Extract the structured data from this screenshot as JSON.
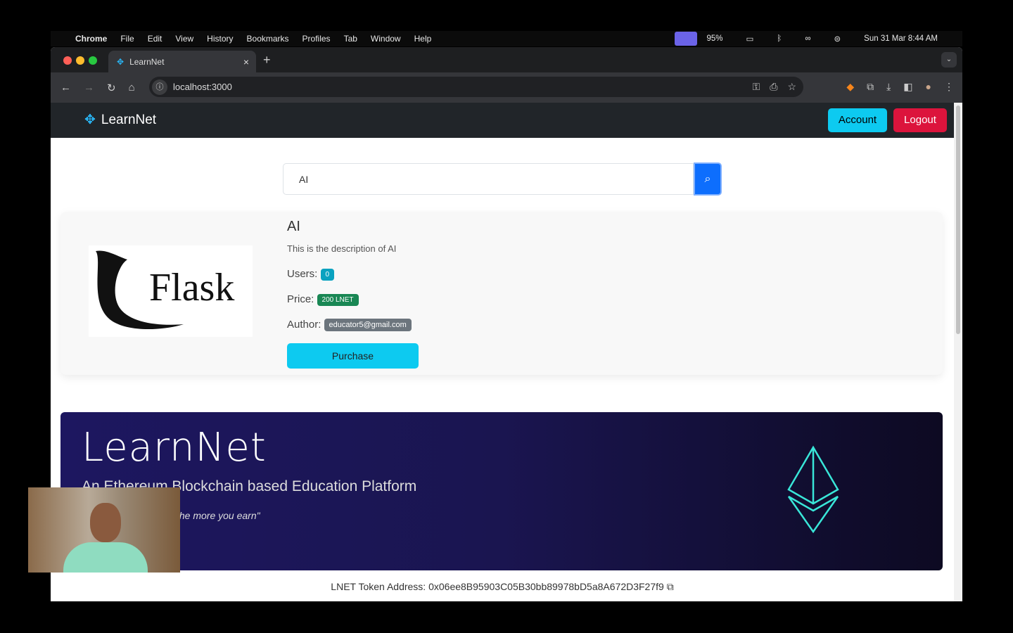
{
  "menubar": {
    "app": "Chrome",
    "items": [
      "File",
      "Edit",
      "View",
      "History",
      "Bookmarks",
      "Profiles",
      "Tab",
      "Window",
      "Help"
    ],
    "battery": "95%",
    "datetime": "Sun 31 Mar  8:44 AM"
  },
  "browser": {
    "tab_title": "LearnNet",
    "url": "localhost:3000"
  },
  "navbar": {
    "brand": "LearnNet",
    "account": "Account",
    "logout": "Logout"
  },
  "search": {
    "value": "AI"
  },
  "course": {
    "title": "AI",
    "description": "This is the description of AI",
    "users_label": "Users:",
    "users": "0",
    "price_label": "Price:",
    "price": "200 LNET",
    "author_label": "Author:",
    "author": "educator5@gmail.com",
    "purchase": "Purchase",
    "image_logo_text": "Flask"
  },
  "hero": {
    "title": "LearnNet",
    "subtitle": "An Ethereum Blockchain based Education Platform",
    "tagline": "the more you earn\""
  },
  "footer": {
    "token_address": "LNET Token Address: 0x06ee8B95903C05B30bb89978bD5a8A672D3F27f9"
  },
  "colors": {
    "account": "#0dcaf0",
    "logout": "#dc143c",
    "search_button": "#0d6efd",
    "users_badge": "#0aa2c0",
    "price_badge": "#198754",
    "author_badge": "#6c757d"
  }
}
